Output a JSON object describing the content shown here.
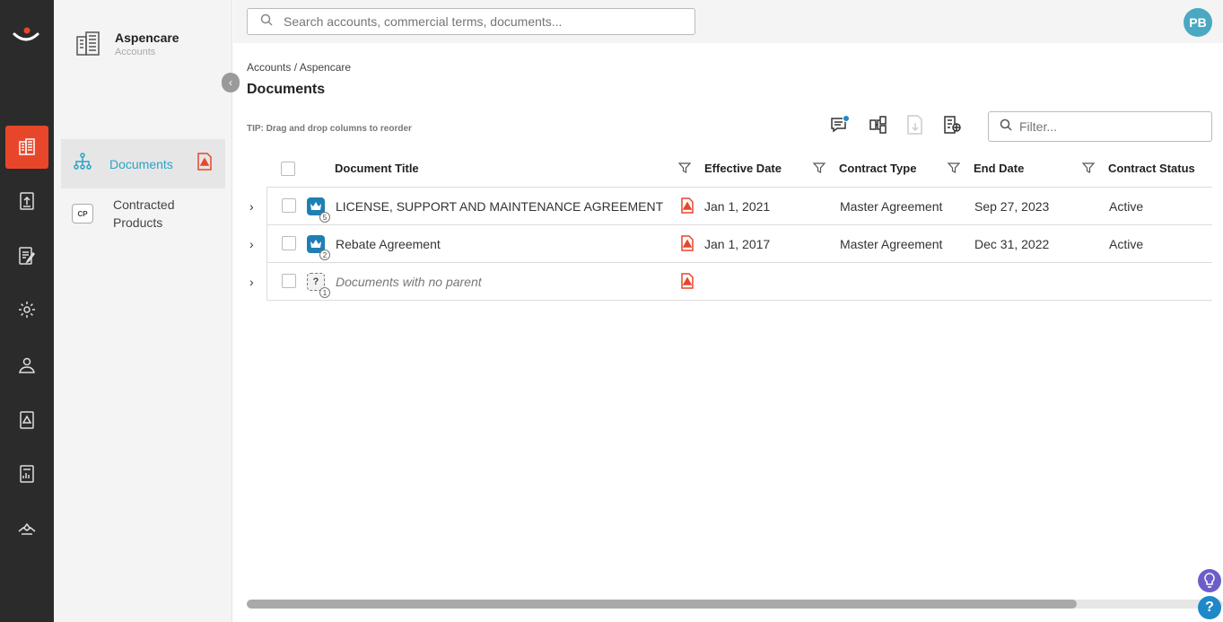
{
  "account": {
    "name": "Aspencare",
    "type": "Accounts"
  },
  "panel_nav": [
    {
      "label": "Documents"
    },
    {
      "label": "Contracted Products",
      "badge": "CP"
    }
  ],
  "search": {
    "placeholder": "Search accounts, commercial terms, documents..."
  },
  "user": {
    "initials": "PB"
  },
  "breadcrumb": "Accounts / Aspencare",
  "page_title": "Documents",
  "tip": "TIP: Drag and drop columns to reorder",
  "filter": {
    "placeholder": "Filter..."
  },
  "columns": [
    "Document Title",
    "Effective Date",
    "Contract Type",
    "End Date",
    "Contract Status"
  ],
  "rows": [
    {
      "title": "LICENSE, SUPPORT AND MAINTENANCE AGREEMENT",
      "count": "5",
      "effective": "Jan 1, 2021",
      "type": "Master Agreement",
      "end": "Sep 27, 2023",
      "status": "Active"
    },
    {
      "title": "Rebate Agreement",
      "count": "2",
      "effective": "Jan 1, 2017",
      "type": "Master Agreement",
      "end": "Dec 31, 2022",
      "status": "Active"
    },
    {
      "title": "Documents with no parent",
      "count": "1",
      "effective": "",
      "type": "",
      "end": "",
      "status": ""
    }
  ],
  "help_label": "?",
  "colors": {
    "accent": "#e8462b",
    "link": "#2aa3c9",
    "rail": "#2b2b2b"
  }
}
